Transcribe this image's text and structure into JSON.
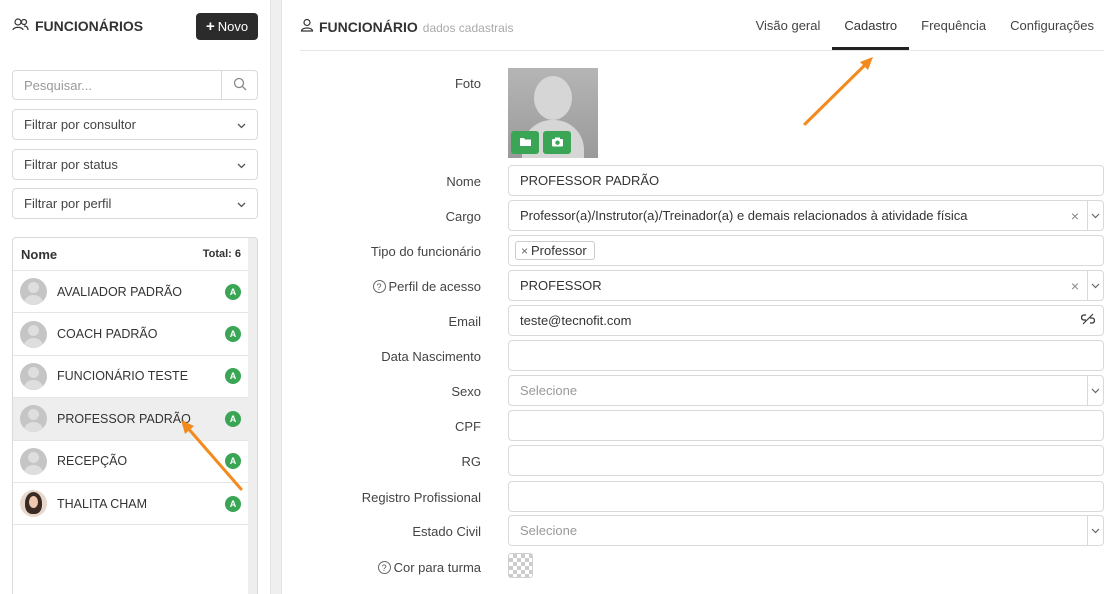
{
  "sidebar": {
    "title": "FUNCIONÁRIOS",
    "new_button": "Novo",
    "search_placeholder": "Pesquisar...",
    "filters": [
      "Filtrar por consultor",
      "Filtrar por status",
      "Filtrar por perfil"
    ],
    "list_header": {
      "name": "Nome",
      "total": "Total: 6"
    },
    "employees": [
      {
        "name": "AVALIADOR PADRÃO",
        "badge": "A"
      },
      {
        "name": "COACH PADRÃO",
        "badge": "A"
      },
      {
        "name": "FUNCIONÁRIO TESTE",
        "badge": "A"
      },
      {
        "name": "PROFESSOR PADRÃO",
        "badge": "A",
        "selected": true
      },
      {
        "name": "RECEPÇÃO",
        "badge": "A"
      },
      {
        "name": "THALITA CHAM",
        "badge": "A",
        "has_photo": true
      }
    ]
  },
  "main": {
    "title": "FUNCIONÁRIO",
    "subtitle": "dados cadastrais",
    "tabs": [
      "Visão geral",
      "Cadastro",
      "Frequência",
      "Configurações"
    ],
    "active_tab": "Cadastro",
    "form": {
      "foto_label": "Foto",
      "nome_label": "Nome",
      "nome_value": "PROFESSOR PADRÃO",
      "cargo_label": "Cargo",
      "cargo_value": "Professor(a)/Instrutor(a)/Treinador(a) e demais relacionados à atividade física",
      "tipo_label": "Tipo do funcionário",
      "tipo_tag": "Professor",
      "perfil_label": "Perfil de acesso",
      "perfil_value": "PROFESSOR",
      "email_label": "Email",
      "email_value": "teste@tecnofit.com",
      "nascimento_label": "Data Nascimento",
      "sexo_label": "Sexo",
      "sexo_placeholder": "Selecione",
      "cpf_label": "CPF",
      "rg_label": "RG",
      "registro_label": "Registro Profissional",
      "estado_civil_label": "Estado Civil",
      "estado_civil_placeholder": "Selecione",
      "cor_label": "Cor para turma"
    }
  },
  "colors": {
    "accent_green": "#3aa655",
    "dark_button": "#2b2b2b",
    "annotation_arrow": "#f28a1e"
  }
}
